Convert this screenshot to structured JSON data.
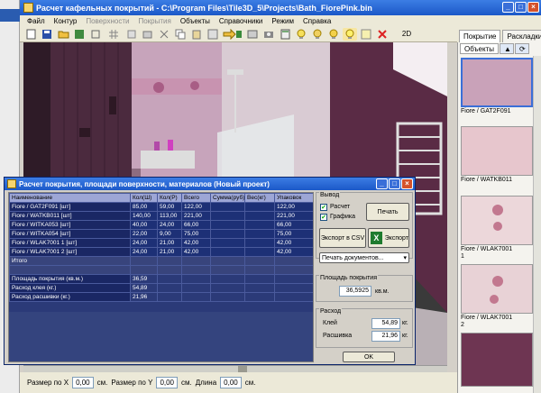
{
  "main_window": {
    "title": "Расчет кафельных покрытий - C:\\Program Files\\Tile3D_5\\Projects\\Bath_FiorePink.bin",
    "menu": [
      {
        "label": "Файл",
        "enabled": true
      },
      {
        "label": "Контур",
        "enabled": true
      },
      {
        "label": "Поверхности",
        "enabled": false
      },
      {
        "label": "Покрытия",
        "enabled": false
      },
      {
        "label": "Объекты",
        "enabled": true
      },
      {
        "label": "Справочники",
        "enabled": true
      },
      {
        "label": "Режим",
        "enabled": true
      },
      {
        "label": "Справка",
        "enabled": true
      }
    ],
    "toolbar_mode_label": "2D",
    "window_buttons": [
      "_",
      "□",
      "×"
    ]
  },
  "right_panel": {
    "tabs": [
      "Покрытие",
      "Раскладки"
    ],
    "subtab": "Объекты",
    "tiles": [
      {
        "name": "Fiore / GAT2F091",
        "color": "#c9a2b9"
      },
      {
        "name": "Fiore / WATKB011",
        "color": "#e7c6cd"
      },
      {
        "name": "Fiore / WLAK7001 1",
        "color": "#ecd7da"
      },
      {
        "name": "Fiore / WLAK7001 2",
        "color": "#e8d2d6"
      },
      {
        "name": "",
        "color": "#6e3552"
      }
    ]
  },
  "status": {
    "size_x_label": "Размер по X",
    "size_x_value": "0,00",
    "size_x_unit": "см.",
    "size_y_label": "Размер по Y",
    "size_y_value": "0,00",
    "size_y_unit": "см.",
    "length_label": "Длина",
    "length_value": "0,00",
    "length_unit": "см."
  },
  "dialog": {
    "title": "Расчет покрытия, площади поверхности, материалов (Новый проект)",
    "columns": [
      "Наименование",
      "Кол(Ш)",
      "Кол(Р)",
      "Всего",
      "Сумма(руб)",
      "Вес(кг)",
      "Упаковок"
    ],
    "rows": [
      [
        "Fiore / GAT2F091 [шт]",
        "85,00",
        "59,00",
        "122,00",
        "",
        "",
        "122,00"
      ],
      [
        "Fiore / WATKB011 [шт]",
        "140,00",
        "113,00",
        "221,00",
        "",
        "",
        "221,00"
      ],
      [
        "Fiore / WITKA053 [шт]",
        "40,00",
        "24,00",
        "66,00",
        "",
        "",
        "66,00"
      ],
      [
        "Fiore / WITKA054 [шт]",
        "22,00",
        "9,00",
        "75,00",
        "",
        "",
        "75,00"
      ],
      [
        "Fiore / WLAK7001 1 [шт]",
        "24,00",
        "21,00",
        "42,00",
        "",
        "",
        "42,00"
      ],
      [
        "Fiore / WLAK7001 2 [шт]",
        "24,00",
        "21,00",
        "42,00",
        "",
        "",
        "42,00"
      ],
      [
        "Итого",
        "",
        "",
        "",
        "",
        "",
        ""
      ],
      [
        "",
        "",
        "",
        "",
        "",
        "",
        ""
      ],
      [
        "Площадь покрытия (кв.м.)",
        "36,59",
        "",
        "",
        "",
        "",
        ""
      ],
      [
        "Расход клея (кг.)",
        "54,89",
        "",
        "",
        "",
        "",
        ""
      ],
      [
        "Расход расшивки (кг.)",
        "21,96",
        "",
        "",
        "",
        "",
        ""
      ]
    ],
    "output_group": "Вывод",
    "calc_checkbox": {
      "label": "Расчет",
      "checked": true
    },
    "graphics_checkbox": {
      "label": "Графика",
      "checked": true
    },
    "print_button": "Печать",
    "export_csv_button": "Экспорт в CSV",
    "export_button": "Экспорт",
    "print_docs_select": "Печать документов...",
    "area_group": "Площадь покрытия",
    "area_value": "36,5925",
    "area_unit": "кв.м.",
    "consumption_group": "Расход",
    "glue_label": "Клей",
    "glue_value": "54,89",
    "glue_unit": "кг.",
    "grout_label": "Расшивка",
    "grout_value": "21,96",
    "grout_unit": "кг.",
    "ok_button": "OK"
  }
}
